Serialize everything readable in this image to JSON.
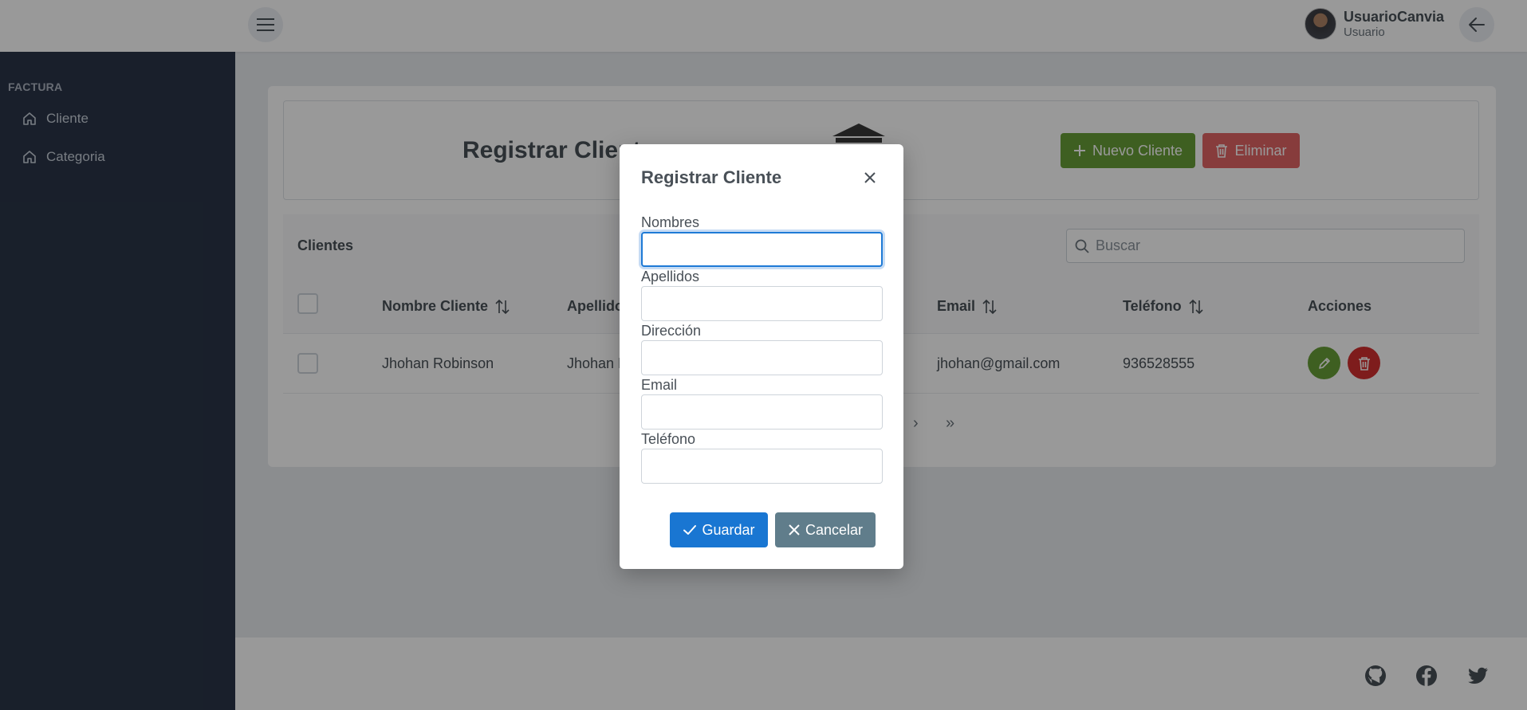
{
  "topbar": {
    "menu_icon": "hamburger-icon",
    "user_name": "UsuarioCanvia",
    "user_role": "Usuario",
    "back_icon": "arrow-left-icon"
  },
  "sidebar": {
    "section": "FACTURA",
    "items": [
      {
        "label": "Cliente",
        "icon": "home-icon"
      },
      {
        "label": "Categoria",
        "icon": "home-icon"
      }
    ]
  },
  "page": {
    "title": "Registrar Cliente",
    "new_button": "Nuevo Cliente",
    "delete_button": "Eliminar",
    "colors": {
      "new": "#689f38",
      "delete": "#e26565"
    }
  },
  "table": {
    "caption": "Clientes",
    "search_placeholder": "Buscar",
    "columns": [
      "Nombre Cliente",
      "Apellidos",
      "Email",
      "Teléfono",
      "Acciones"
    ],
    "rows": [
      {
        "nombre": "Jhohan Robinson",
        "apellidos": "Jhohan R",
        "email": "jhohan@gmail.com",
        "telefono": "936528555"
      }
    ],
    "pager": {
      "next": "›",
      "last": "»"
    }
  },
  "footer": {
    "icons": [
      "github-icon",
      "facebook-icon",
      "twitter-icon"
    ]
  },
  "modal": {
    "title": "Registrar Cliente",
    "fields": [
      {
        "label": "Nombres",
        "value": ""
      },
      {
        "label": "Apellidos",
        "value": ""
      },
      {
        "label": "Dirección",
        "value": ""
      },
      {
        "label": "Email",
        "value": ""
      },
      {
        "label": "Teléfono",
        "value": ""
      }
    ],
    "save_button": "Guardar",
    "cancel_button": "Cancelar",
    "colors": {
      "save": "#1976d2",
      "cancel": "#607d8b"
    }
  }
}
